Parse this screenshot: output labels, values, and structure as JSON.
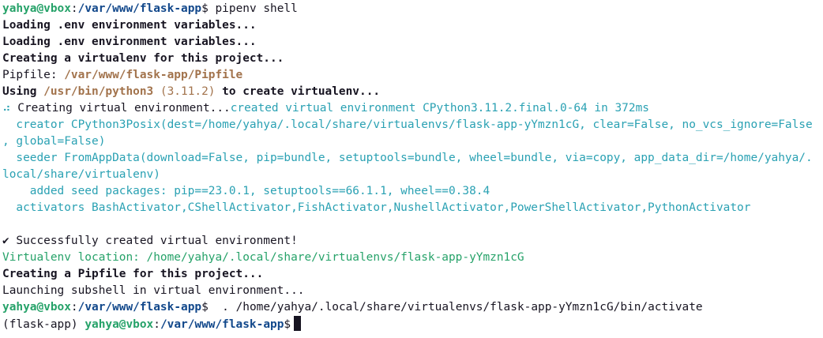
{
  "prompt1": {
    "user": "yahya@vbox",
    "sep": ":",
    "path": "/var/www/flask-app",
    "symbol": "$",
    "command": " pipenv shell"
  },
  "out": {
    "load_env_1": "Loading .env environment variables...",
    "load_env_2": "Loading .env environment variables...",
    "creating_venv": "Creating a virtualenv for this project...",
    "pipfile_label": "Pipfile: ",
    "pipfile_path": "/var/www/flask-app/Pipfile",
    "using_label": "Using ",
    "python_path": "/usr/bin/python3",
    "python_version": " (3.11.2)",
    "to_create": " to create virtualenv...",
    "spinner": "⠴",
    "creating_env_text": " Creating virtual environment...",
    "created_env_text": "created virtual environment CPython3.11.2.final.0-64 in 372ms",
    "creator_line_1": "  creator CPython3Posix(dest=/home/yahya/.local/share/virtualenvs/flask-app-yYmzn1cG, clear=False, no_vcs_ignore=False",
    "creator_line_2": ", global=False)",
    "seeder_line_1": "  seeder FromAppData(download=False, pip=bundle, setuptools=bundle, wheel=bundle, via=copy, app_data_dir=/home/yahya/.",
    "seeder_line_2": "local/share/virtualenv)",
    "seed_packages": "    added seed packages: pip==23.0.1, setuptools==66.1.1, wheel==0.38.4",
    "activators": "  activators BashActivator,CShellActivator,FishActivator,NushellActivator,PowerShellActivator,PythonActivator",
    "check_mark": "✔",
    "success_text": " Successfully created virtual environment!",
    "venv_location": "Virtualenv location: /home/yahya/.local/share/virtualenvs/flask-app-yYmzn1cG",
    "creating_pipfile": "Creating a Pipfile for this project...",
    "launching_subshell": "Launching subshell in virtual environment..."
  },
  "prompt2": {
    "user": "yahya@vbox",
    "sep": ":",
    "path": "/var/www/flask-app",
    "symbol": "$",
    "command": "  . /home/yahya/.local/share/virtualenvs/flask-app-yYmzn1cG/bin/activate"
  },
  "prompt3": {
    "venv": "(flask-app) ",
    "user": "yahya@vbox",
    "sep": ":",
    "path": "/var/www/flask-app",
    "symbol": "$",
    "command": " "
  },
  "colors": {
    "background": "#ffffff",
    "foreground": "#171421",
    "user_host": "#26a269",
    "path": "#12488b",
    "info_cyan": "#2aa1b3",
    "path_orange": "#a2734c"
  }
}
